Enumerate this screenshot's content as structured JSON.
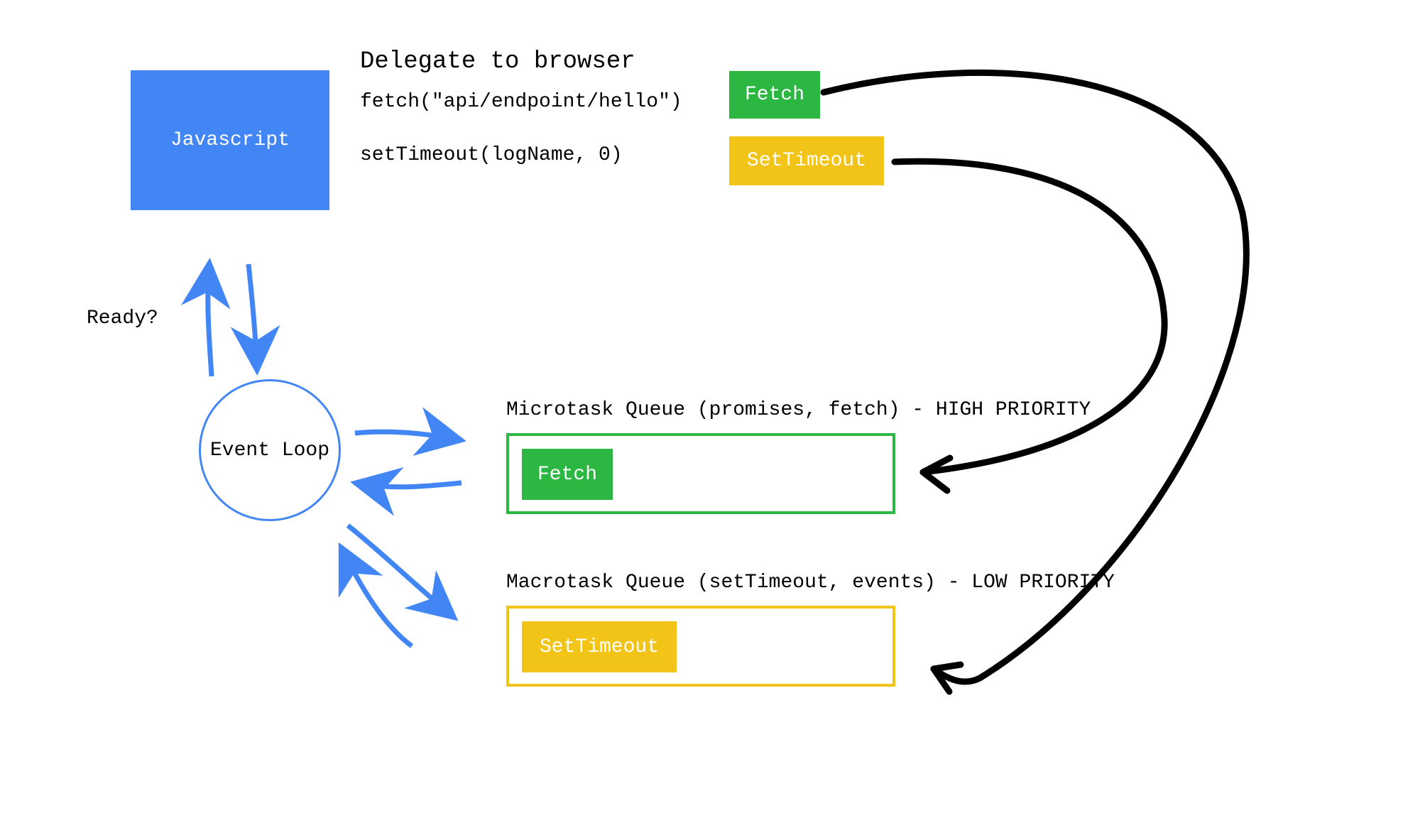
{
  "javascript_box": "Javascript",
  "delegate_title": "Delegate to browser",
  "code_line_1": "fetch(\"api/endpoint/hello\")",
  "code_line_2": "setTimeout(logName, 0)",
  "fetch_block": "Fetch",
  "timeout_block": "SetTimeout",
  "ready_label": "Ready?",
  "event_loop": "Event Loop",
  "microtask_label": "Microtask Queue (promises, fetch) - HIGH PRIORITY",
  "macrotask_label": "Macrotask Queue (setTimeout, events) - LOW PRIORITY",
  "micro_item": "Fetch",
  "macro_item": "SetTimeout",
  "colors": {
    "blue": "#4285f4",
    "green": "#2cb742",
    "yellow": "#f2c418",
    "black": "#000000"
  }
}
